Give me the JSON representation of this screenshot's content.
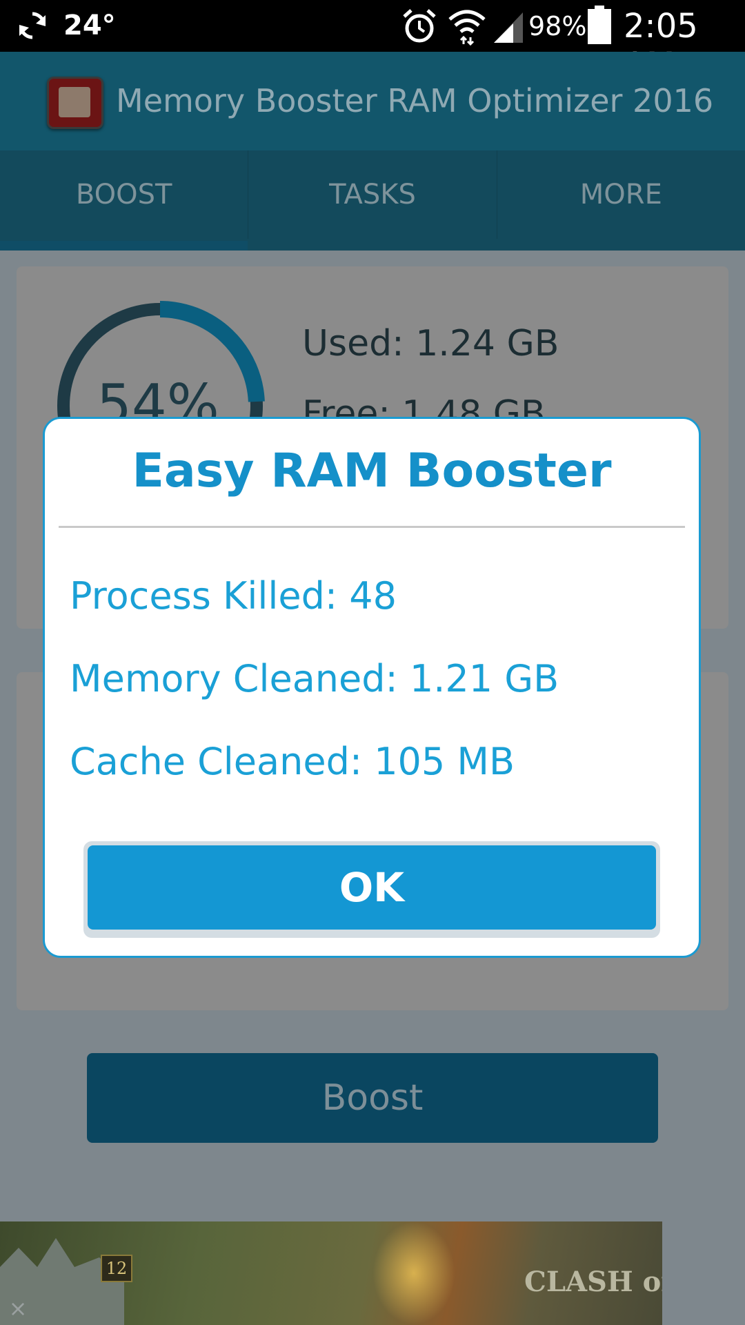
{
  "status_bar": {
    "temperature": "24°",
    "battery_percent": "98%",
    "time": "2:05 AM"
  },
  "app": {
    "title": "Memory Booster RAM Optimizer 2016",
    "tabs": [
      {
        "label": "BOOST",
        "active": true
      },
      {
        "label": "TASKS",
        "active": false
      },
      {
        "label": "MORE",
        "active": false
      }
    ]
  },
  "memory": {
    "percent_label": "54%",
    "percent": 0.54,
    "used_label": "Used:",
    "used_value": "1.24 GB",
    "free_label": "Free:",
    "free_value": "1.48 GB"
  },
  "boost_button": "Boost",
  "ad": {
    "badge": "12",
    "brand": "CLASH of KINGS",
    "close": "×"
  },
  "dialog": {
    "title": "Easy RAM Booster",
    "process_killed": "Process Killed: 48",
    "memory_cleaned": "Memory Cleaned: 1.21 GB",
    "cache_cleaned": "Cache Cleaned: 105 MB",
    "ok_label": "OK"
  },
  "colors": {
    "accent": "#1497d3",
    "dialog_text": "#1aa0d6",
    "overlay_header": "#12566b"
  }
}
